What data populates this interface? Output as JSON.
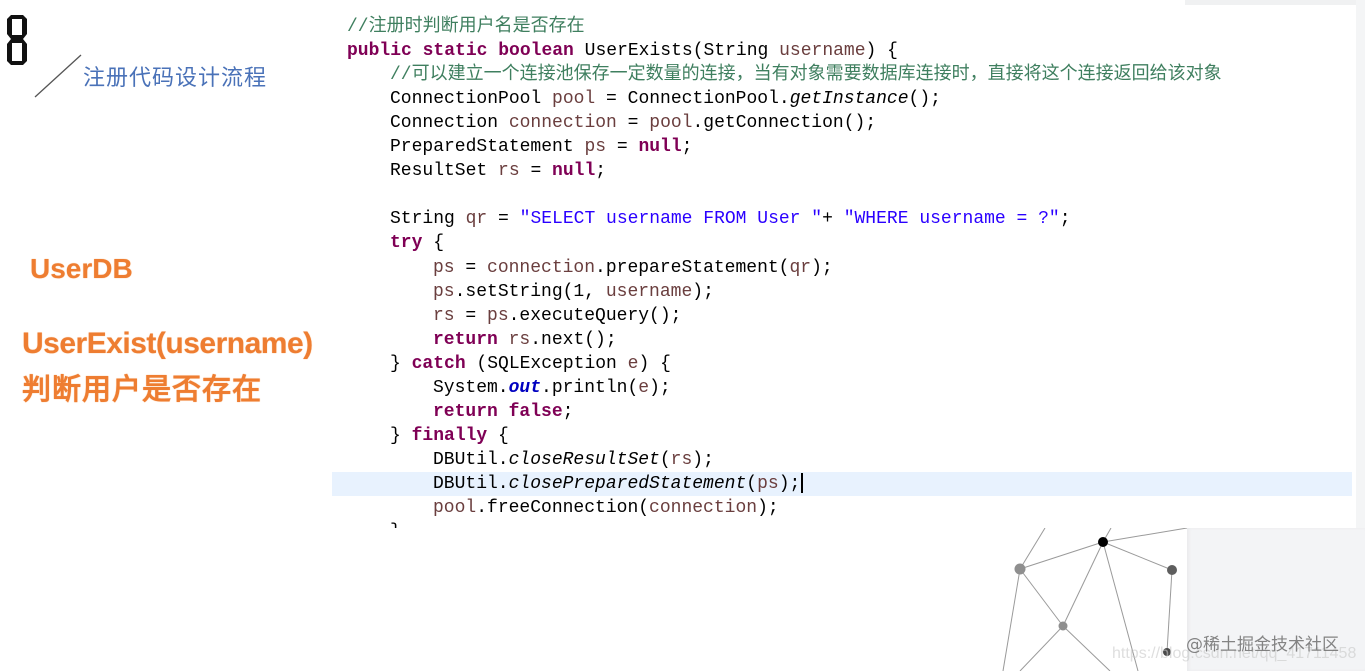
{
  "slide": {
    "section_number": "8",
    "section_title": "注册代码设计流程",
    "class_name": "UserDB",
    "method_name": "UserExist(username)",
    "method_description": "判断用户是否存在"
  },
  "colors": {
    "title_blue": "#4a72b8",
    "accent_orange": "#ee7d31",
    "keyword": "#7f0055",
    "variable": "#6a3e3e",
    "string": "#2a00ff",
    "comment": "#3f7f5f",
    "static_field": "#0000c0",
    "current_line_highlight": "#e8f2fe"
  },
  "code": {
    "highlighted_line": 19,
    "cursor_line": 19,
    "lines": [
      {
        "indent": 0,
        "tokens": [
          {
            "k": "cm",
            "v": "//注册时判断用户名是否存在"
          }
        ]
      },
      {
        "indent": 0,
        "tokens": [
          {
            "k": "kw",
            "v": "public"
          },
          {
            "k": "p",
            "v": " "
          },
          {
            "k": "kw",
            "v": "static"
          },
          {
            "k": "p",
            "v": " "
          },
          {
            "k": "kw",
            "v": "boolean"
          },
          {
            "k": "p",
            "v": " UserExists(String "
          },
          {
            "k": "var",
            "v": "username"
          },
          {
            "k": "p",
            "v": ") {"
          }
        ]
      },
      {
        "indent": 1,
        "tokens": [
          {
            "k": "cm",
            "v": "//可以建立一个连接池保存一定数量的连接，当有对象需要数据库连接时，直接将这个连接返回给该对象"
          }
        ]
      },
      {
        "indent": 1,
        "tokens": [
          {
            "k": "p",
            "v": "ConnectionPool "
          },
          {
            "k": "var",
            "v": "pool"
          },
          {
            "k": "p",
            "v": " = ConnectionPool."
          },
          {
            "k": "it",
            "v": "getInstance"
          },
          {
            "k": "p",
            "v": "();"
          }
        ]
      },
      {
        "indent": 1,
        "tokens": [
          {
            "k": "p",
            "v": "Connection "
          },
          {
            "k": "var",
            "v": "connection"
          },
          {
            "k": "p",
            "v": " = "
          },
          {
            "k": "var",
            "v": "pool"
          },
          {
            "k": "p",
            "v": ".getConnection();"
          }
        ]
      },
      {
        "indent": 1,
        "tokens": [
          {
            "k": "p",
            "v": "PreparedStatement "
          },
          {
            "k": "var",
            "v": "ps"
          },
          {
            "k": "p",
            "v": " = "
          },
          {
            "k": "kw",
            "v": "null"
          },
          {
            "k": "p",
            "v": ";"
          }
        ]
      },
      {
        "indent": 1,
        "tokens": [
          {
            "k": "p",
            "v": "ResultSet "
          },
          {
            "k": "var",
            "v": "rs"
          },
          {
            "k": "p",
            "v": " = "
          },
          {
            "k": "kw",
            "v": "null"
          },
          {
            "k": "p",
            "v": ";"
          }
        ]
      },
      {
        "indent": 0,
        "tokens": []
      },
      {
        "indent": 1,
        "tokens": [
          {
            "k": "p",
            "v": "String "
          },
          {
            "k": "var",
            "v": "qr"
          },
          {
            "k": "p",
            "v": " = "
          },
          {
            "k": "str",
            "v": "\"SELECT username FROM User \""
          },
          {
            "k": "p",
            "v": "+ "
          },
          {
            "k": "str",
            "v": "\"WHERE username = ?\""
          },
          {
            "k": "p",
            "v": ";"
          }
        ]
      },
      {
        "indent": 1,
        "tokens": [
          {
            "k": "kw",
            "v": "try"
          },
          {
            "k": "p",
            "v": " {"
          }
        ]
      },
      {
        "indent": 2,
        "tokens": [
          {
            "k": "var",
            "v": "ps"
          },
          {
            "k": "p",
            "v": " = "
          },
          {
            "k": "var",
            "v": "connection"
          },
          {
            "k": "p",
            "v": ".prepareStatement("
          },
          {
            "k": "var",
            "v": "qr"
          },
          {
            "k": "p",
            "v": ");"
          }
        ]
      },
      {
        "indent": 2,
        "tokens": [
          {
            "k": "var",
            "v": "ps"
          },
          {
            "k": "p",
            "v": ".setString(1, "
          },
          {
            "k": "var",
            "v": "username"
          },
          {
            "k": "p",
            "v": ");"
          }
        ]
      },
      {
        "indent": 2,
        "tokens": [
          {
            "k": "var",
            "v": "rs"
          },
          {
            "k": "p",
            "v": " = "
          },
          {
            "k": "var",
            "v": "ps"
          },
          {
            "k": "p",
            "v": ".executeQuery();"
          }
        ]
      },
      {
        "indent": 2,
        "tokens": [
          {
            "k": "kw",
            "v": "return"
          },
          {
            "k": "p",
            "v": " "
          },
          {
            "k": "var",
            "v": "rs"
          },
          {
            "k": "p",
            "v": ".next();"
          }
        ]
      },
      {
        "indent": 1,
        "tokens": [
          {
            "k": "p",
            "v": "} "
          },
          {
            "k": "kw",
            "v": "catch"
          },
          {
            "k": "p",
            "v": " (SQLException "
          },
          {
            "k": "var",
            "v": "e"
          },
          {
            "k": "p",
            "v": ") {"
          }
        ]
      },
      {
        "indent": 2,
        "tokens": [
          {
            "k": "p",
            "v": "System."
          },
          {
            "k": "field",
            "v": "out"
          },
          {
            "k": "p",
            "v": ".println("
          },
          {
            "k": "var",
            "v": "e"
          },
          {
            "k": "p",
            "v": ");"
          }
        ]
      },
      {
        "indent": 2,
        "tokens": [
          {
            "k": "kw",
            "v": "return"
          },
          {
            "k": "p",
            "v": " "
          },
          {
            "k": "kw",
            "v": "false"
          },
          {
            "k": "p",
            "v": ";"
          }
        ]
      },
      {
        "indent": 1,
        "tokens": [
          {
            "k": "p",
            "v": "} "
          },
          {
            "k": "kw",
            "v": "finally"
          },
          {
            "k": "p",
            "v": " {"
          }
        ]
      },
      {
        "indent": 2,
        "tokens": [
          {
            "k": "p",
            "v": "DBUtil."
          },
          {
            "k": "it",
            "v": "closeResultSet"
          },
          {
            "k": "p",
            "v": "("
          },
          {
            "k": "var",
            "v": "rs"
          },
          {
            "k": "p",
            "v": ");"
          }
        ]
      },
      {
        "indent": 2,
        "tokens": [
          {
            "k": "p",
            "v": "DBUtil."
          },
          {
            "k": "it",
            "v": "closePreparedStatement"
          },
          {
            "k": "p",
            "v": "("
          },
          {
            "k": "var",
            "v": "ps"
          },
          {
            "k": "p",
            "v": ");"
          }
        ]
      },
      {
        "indent": 2,
        "tokens": [
          {
            "k": "var",
            "v": "pool"
          },
          {
            "k": "p",
            "v": ".freeConnection("
          },
          {
            "k": "var",
            "v": "connection"
          },
          {
            "k": "p",
            "v": ");"
          }
        ]
      },
      {
        "indent": 1,
        "tokens": [
          {
            "k": "p",
            "v": "}"
          }
        ]
      }
    ]
  },
  "watermark": {
    "text": "@稀土掘金技术社区",
    "url": "https://blog.csdn.net/qq_41711458"
  }
}
